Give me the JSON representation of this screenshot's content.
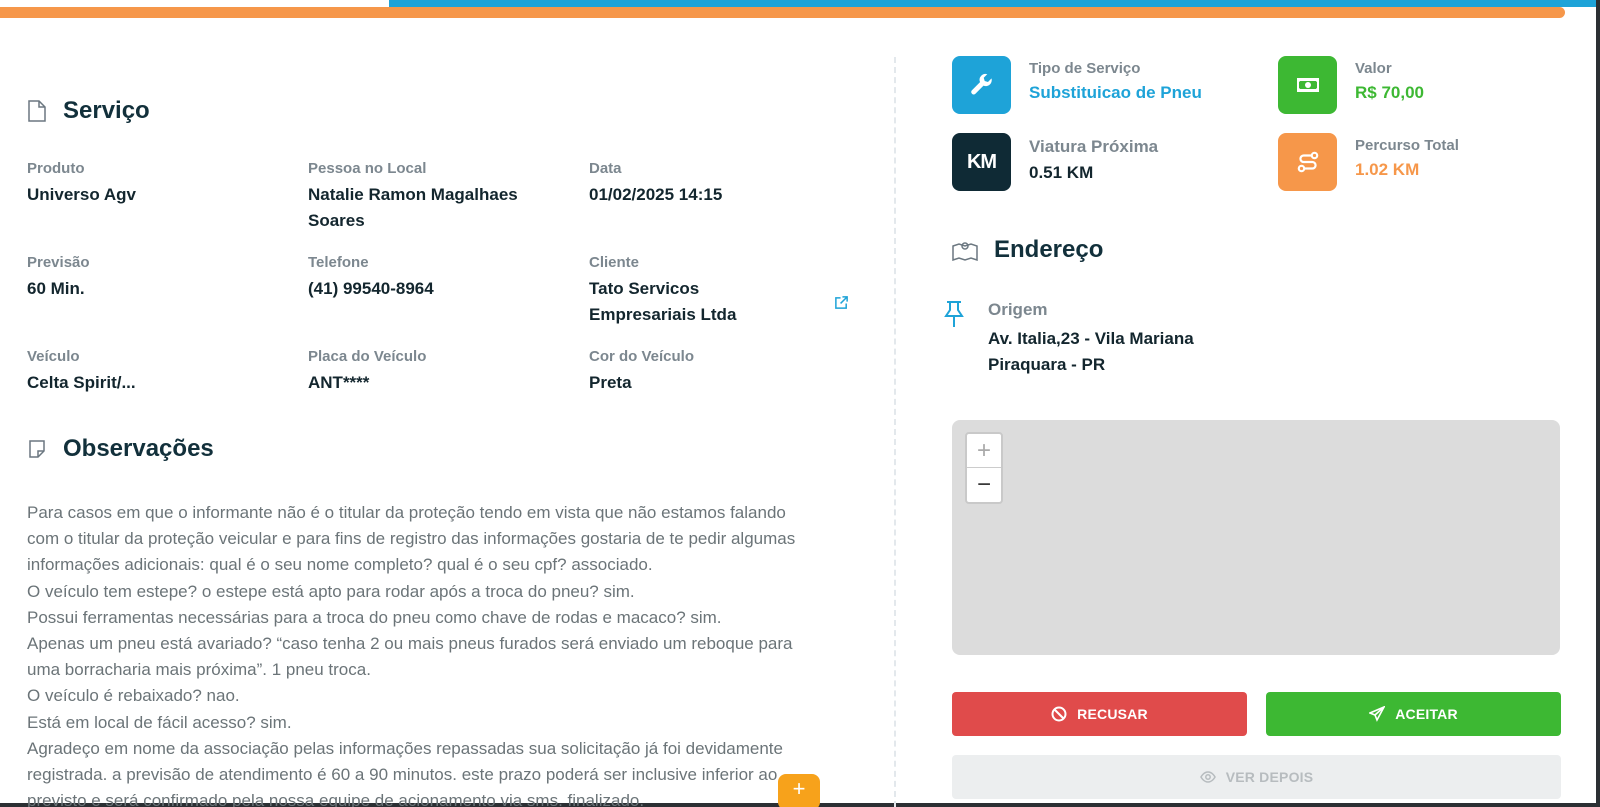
{
  "service": {
    "title": "Serviço",
    "fields": [
      {
        "label": "Produto",
        "value": "Universo Agv"
      },
      {
        "label": "Pessoa no Local",
        "value_lines": [
          "Natalie Ramon Magalhaes",
          "Soares"
        ]
      },
      {
        "label": "Data",
        "value": "01/02/2025 14:15"
      },
      {
        "label": "Previsão",
        "value": "60 Min."
      },
      {
        "label": "Telefone",
        "value": "(41) 99540-8964"
      },
      {
        "label": "Cliente",
        "value_lines": [
          "Tato Servicos",
          "Empresariais Ltda"
        ]
      },
      {
        "label": "Veículo",
        "value": "Celta Spirit/..."
      },
      {
        "label": "Placa do Veículo",
        "value": "ANT****"
      },
      {
        "label": "Cor do Veículo",
        "value": "Preta"
      }
    ]
  },
  "observations": {
    "title": "Observações",
    "lines": [
      "Para casos em que o informante não é o titular da proteção tendo em vista que não estamos falando",
      "com o titular da proteção veicular e para fins de registro das informações gostaria de te pedir algumas",
      "informações adicionais: qual é o seu nome completo? qual é o seu cpf? associado.",
      "O veículo tem estepe? o estepe está apto para rodar após a troca do pneu? sim.",
      "Possui ferramentas necessárias para a troca do pneu como chave de rodas e macaco? sim.",
      "Apenas um pneu está avariado? “caso tenha 2 ou mais pneus furados será enviado um reboque para",
      "uma borracharia mais próxima”. 1 pneu troca.",
      "O veículo é rebaixado? nao.",
      "Está em local de fácil acesso? sim.",
      "Agradeço em nome da associação pelas informações repassadas sua solicitação já foi devidamente",
      "registrada. a previsão de atendimento é 60 a 90 minutos. este prazo poderá ser inclusive inferior ao",
      "previsto e será confirmado pela nossa equipe de acionamento via sms. finalizado."
    ],
    "fab_label": "+"
  },
  "stats": {
    "service_type": {
      "label": "Tipo de Serviço",
      "value": "Substituicao de Pneu",
      "icon": "wrench-icon",
      "color": "#1ea3d8"
    },
    "value": {
      "label": "Valor",
      "value": "R$ 70,00",
      "icon": "money-icon",
      "color": "#3db833"
    },
    "nearby": {
      "label": "Viatura Próxima",
      "value": "0.51 KM",
      "icon_text": "KM",
      "color": "#0f2a35"
    },
    "route": {
      "label": "Percurso Total",
      "value": "1.02 KM",
      "icon": "route-icon",
      "color": "#f6974a"
    }
  },
  "address": {
    "title": "Endereço",
    "origin_label": "Origem",
    "origin_line1": "Av. Italia,23 - Vila Mariana",
    "origin_line2": "Piraquara - PR"
  },
  "map": {
    "zoom_in": "+",
    "zoom_out": "−"
  },
  "actions": {
    "refuse": "RECUSAR",
    "accept": "ACEITAR",
    "later": "VER DEPOIS"
  }
}
